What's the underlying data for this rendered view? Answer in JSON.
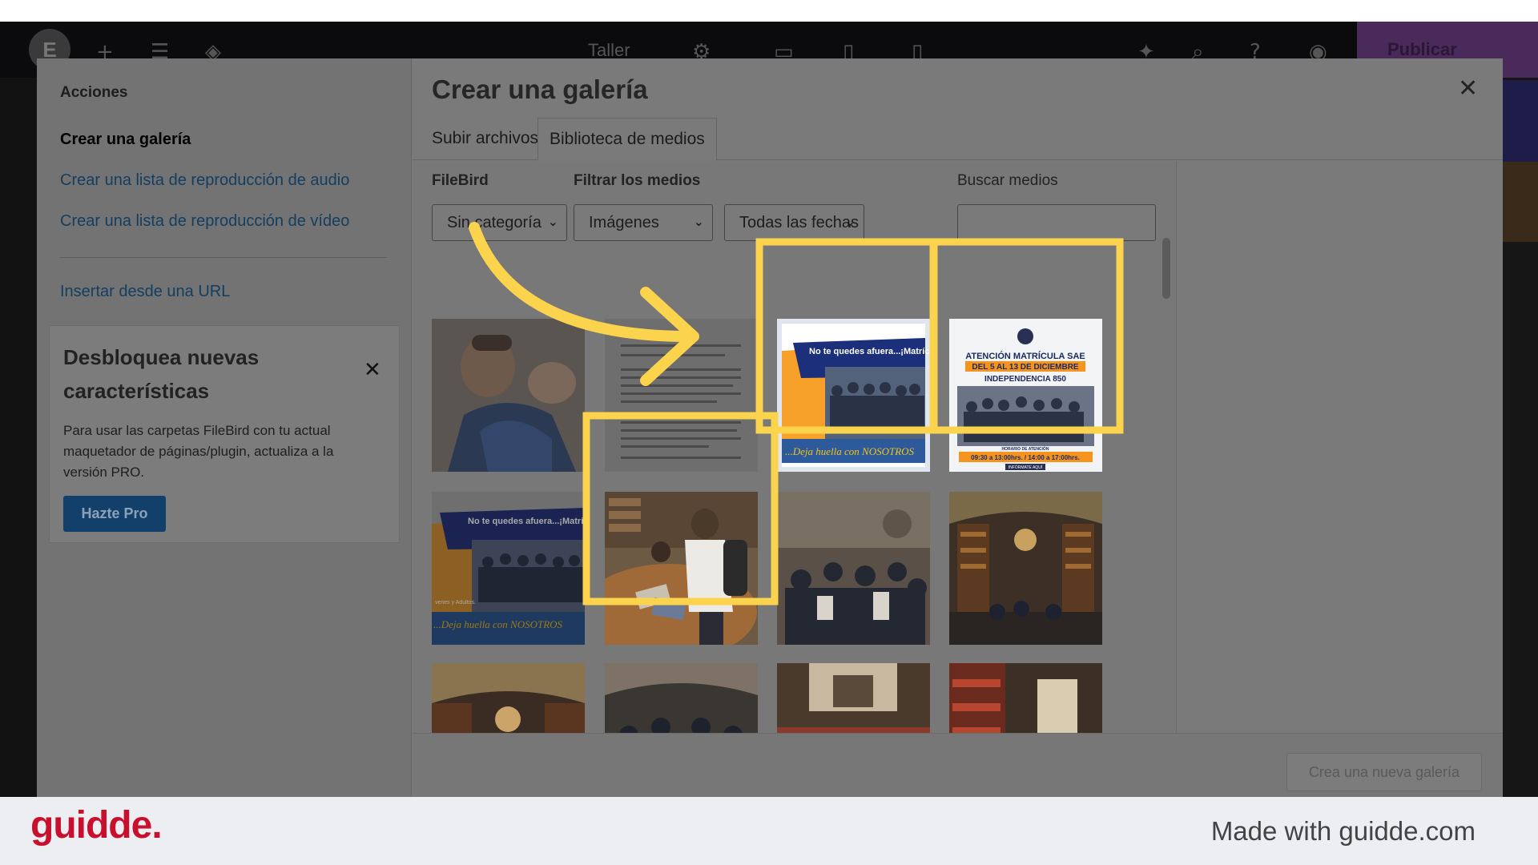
{
  "editor": {
    "device_label": "Taller",
    "publish_label": "Publicar"
  },
  "modal": {
    "title": "Crear una galería",
    "close_icon": "close-icon"
  },
  "sidebar": {
    "heading": "Acciones",
    "items": [
      {
        "label": "Crear una galería"
      },
      {
        "label": "Crear una lista de reproducción de audio"
      },
      {
        "label": "Crear una lista de reproducción de vídeo"
      },
      {
        "label": "Insertar desde una URL"
      }
    ]
  },
  "promo": {
    "title": "Desbloquea nuevas características",
    "text": "Para usar las carpetas FileBird con tu actual maquetador de páginas/plugin, actualiza a la versión PRO.",
    "button_label": "Hazte Pro"
  },
  "tabs": [
    {
      "label": "Subir archivos"
    },
    {
      "label": "Biblioteca de medios",
      "active": true
    }
  ],
  "filters": {
    "filebird_label": "FileBird",
    "filebird_value": "Sin categoría",
    "filter_label": "Filtrar los medios",
    "type_value": "Imágenes",
    "date_value": "Todas las fechas",
    "search_label": "Buscar medios",
    "search_value": ""
  },
  "thumbnails": {
    "flyer_banner": "No te quedes afuera...¡Matrícula",
    "flyer_side": "venes y Adultos.",
    "flyer_slogan": "...Deja huella con NOSOTROS",
    "poster_title_1": "ATENCIÓN MATRÍCULA SAE",
    "poster_title_2": "DEL 5 AL 13 DE DICIEMBRE",
    "poster_title_3": "INDEPENDENCIA 850",
    "poster_hours_label": "HORARIO DE ATENCIÓN",
    "poster_hours": "09:30 a 13:00hrs. / 14:00 a 17:00hrs.",
    "poster_button": "INFÓRMATE AQUÍ"
  },
  "footer": {
    "create_button_label": "Crea una nueva galería"
  },
  "brand": {
    "logo_text": "guidde.",
    "made_with": "Made with guidde.com"
  },
  "colors": {
    "highlight": "#FCD34D",
    "brand_red": "#c8102e",
    "link_blue": "#143e60"
  }
}
